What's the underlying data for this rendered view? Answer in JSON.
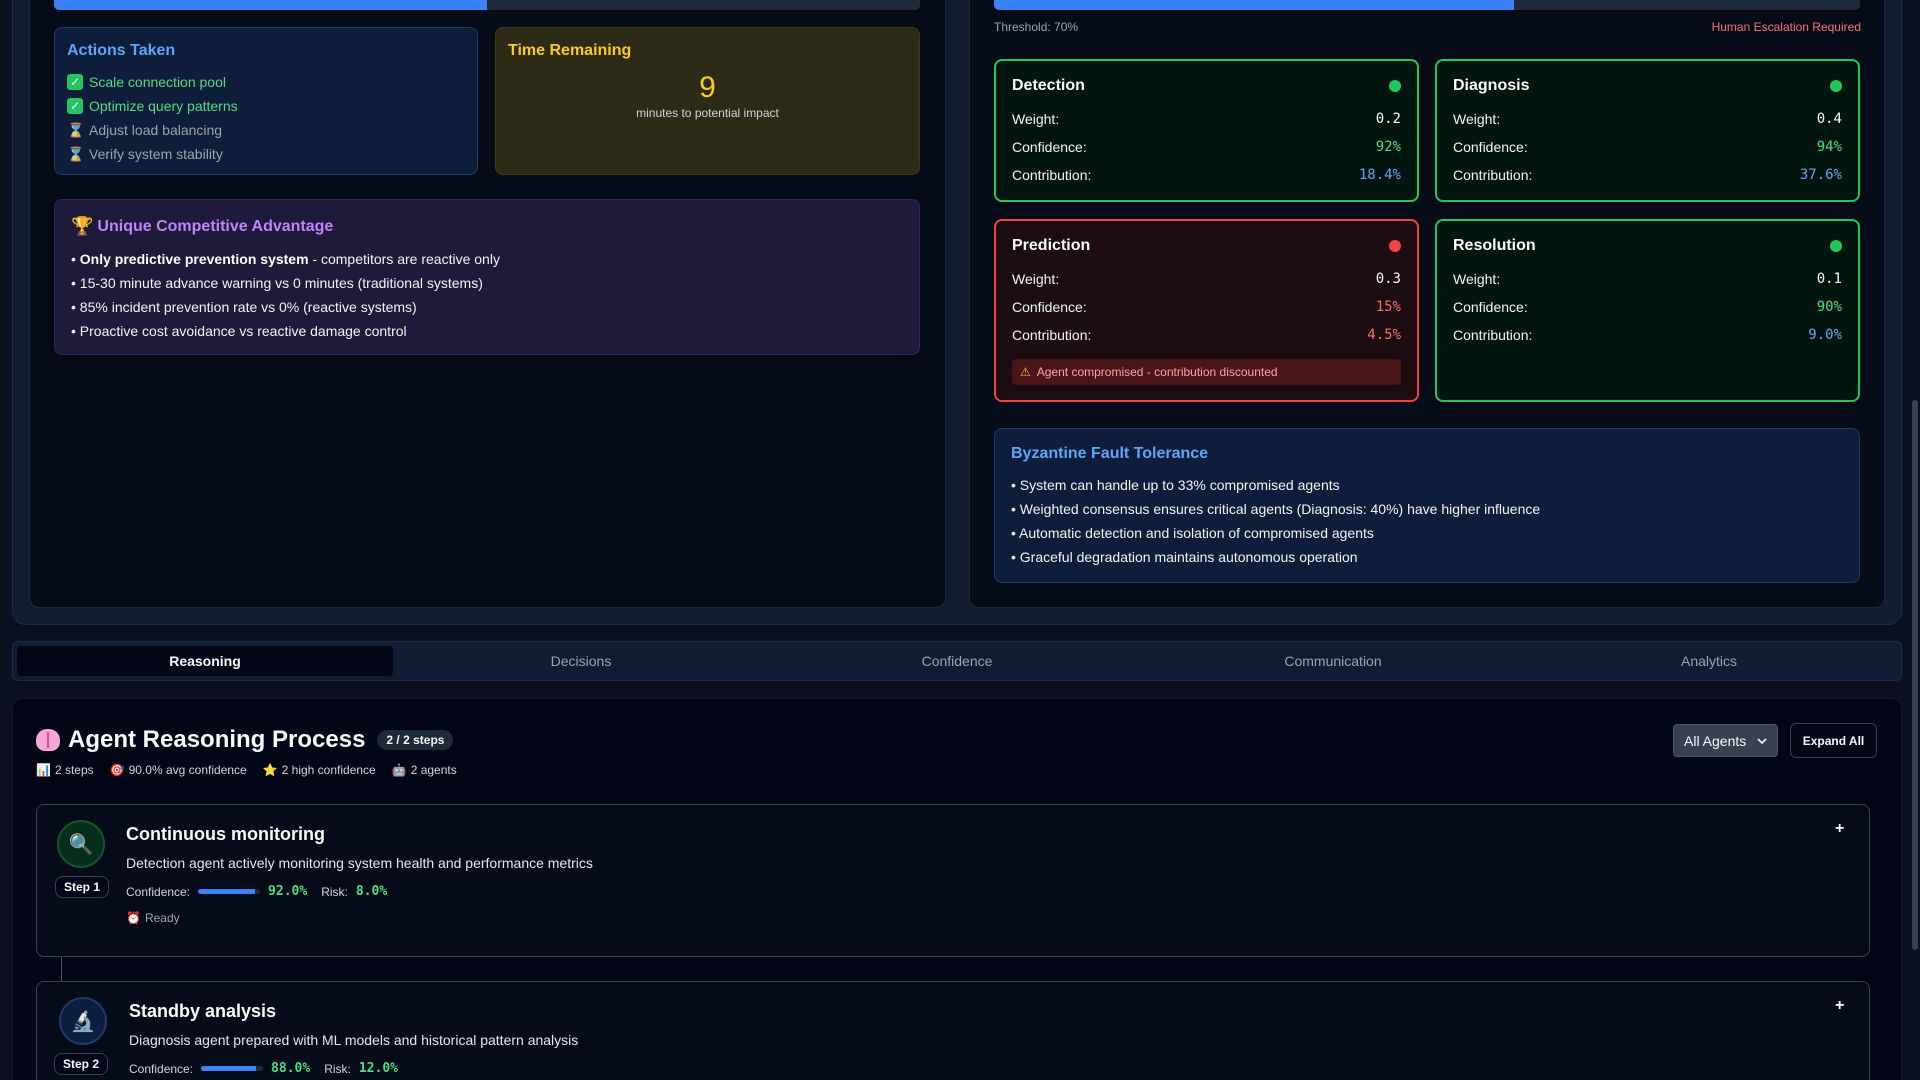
{
  "actions": {
    "title": "Actions Taken",
    "items": [
      {
        "label": "Scale connection pool",
        "done": true
      },
      {
        "label": "Optimize query patterns",
        "done": true
      },
      {
        "label": "Adjust load balancing",
        "done": false
      },
      {
        "label": "Verify system stability",
        "done": false
      }
    ]
  },
  "time_remaining": {
    "title": "Time Remaining",
    "value": "9",
    "subtitle": "minutes to potential impact"
  },
  "advantage": {
    "title": "Unique Competitive Advantage",
    "items": [
      {
        "bold": "Only predictive prevention system",
        "rest": " - competitors are reactive only"
      },
      {
        "bold": "",
        "rest": "15-30 minute advance warning vs 0 minutes (traditional systems)"
      },
      {
        "bold": "",
        "rest": "85% incident prevention rate vs 0% (reactive systems)"
      },
      {
        "bold": "",
        "rest": "Proactive cost avoidance vs reactive damage control"
      }
    ]
  },
  "consensus": {
    "progress_left": 0.5,
    "progress_right": 0.6,
    "threshold_label": "Threshold: 70%",
    "escalation_label": "Human Escalation Required"
  },
  "agents": [
    {
      "name": "Detection",
      "status": "ok",
      "weight": "0.2",
      "confidence": "92%",
      "contribution": "18.4%"
    },
    {
      "name": "Diagnosis",
      "status": "ok",
      "weight": "0.4",
      "confidence": "94%",
      "contribution": "37.6%"
    },
    {
      "name": "Prediction",
      "status": "compromised",
      "weight": "0.3",
      "confidence": "15%",
      "contribution": "4.5%",
      "warning": "Agent compromised - contribution discounted"
    },
    {
      "name": "Resolution",
      "status": "ok",
      "weight": "0.1",
      "confidence": "90%",
      "contribution": "9.0%"
    }
  ],
  "labels": {
    "weight": "Weight:",
    "confidence": "Confidence:",
    "contribution": "Contribution:"
  },
  "byzantine": {
    "title": "Byzantine Fault Tolerance",
    "items": [
      "System can handle up to 33% compromised agents",
      "Weighted consensus ensures critical agents (Diagnosis: 40%) have higher influence",
      "Automatic detection and isolation of compromised agents",
      "Graceful degradation maintains autonomous operation"
    ]
  },
  "tabs": [
    {
      "label": "Reasoning",
      "active": true
    },
    {
      "label": "Decisions",
      "active": false
    },
    {
      "label": "Confidence",
      "active": false
    },
    {
      "label": "Communication",
      "active": false
    },
    {
      "label": "Analytics",
      "active": false
    }
  ],
  "reasoning": {
    "title": "Agent Reasoning Process",
    "steps_badge": "2 / 2 steps",
    "stats": [
      {
        "icon": "chart-icon",
        "label": "2 steps"
      },
      {
        "icon": "target-icon",
        "label": "90.0% avg confidence"
      },
      {
        "icon": "star-icon",
        "label": "2 high confidence"
      },
      {
        "icon": "robot-icon",
        "label": "2 agents"
      }
    ],
    "filter_value": "All Agents",
    "expand_label": "Expand All",
    "confidence_label": "Confidence:",
    "risk_label": "Risk:",
    "steps": [
      {
        "tag": "Step 1",
        "icon": "magnifier-icon",
        "title": "Continuous monitoring",
        "description": "Detection agent actively monitoring system health and performance metrics",
        "confidence": "92.0%",
        "confidence_fraction": 0.92,
        "risk": "8.0%",
        "status": "Ready"
      },
      {
        "tag": "Step 2",
        "icon": "microscope-icon",
        "title": "Standby analysis",
        "description": "Diagnosis agent prepared with ML models and historical pattern analysis",
        "confidence": "88.0%",
        "confidence_fraction": 0.88,
        "risk": "12.0%",
        "status": ""
      }
    ]
  },
  "colors": {
    "accent_blue": "#3b82f6",
    "ok_green": "#22c55e",
    "alert_red": "#ef4444",
    "warning_yellow": "#facc15",
    "purple_title": "#c084fc"
  }
}
